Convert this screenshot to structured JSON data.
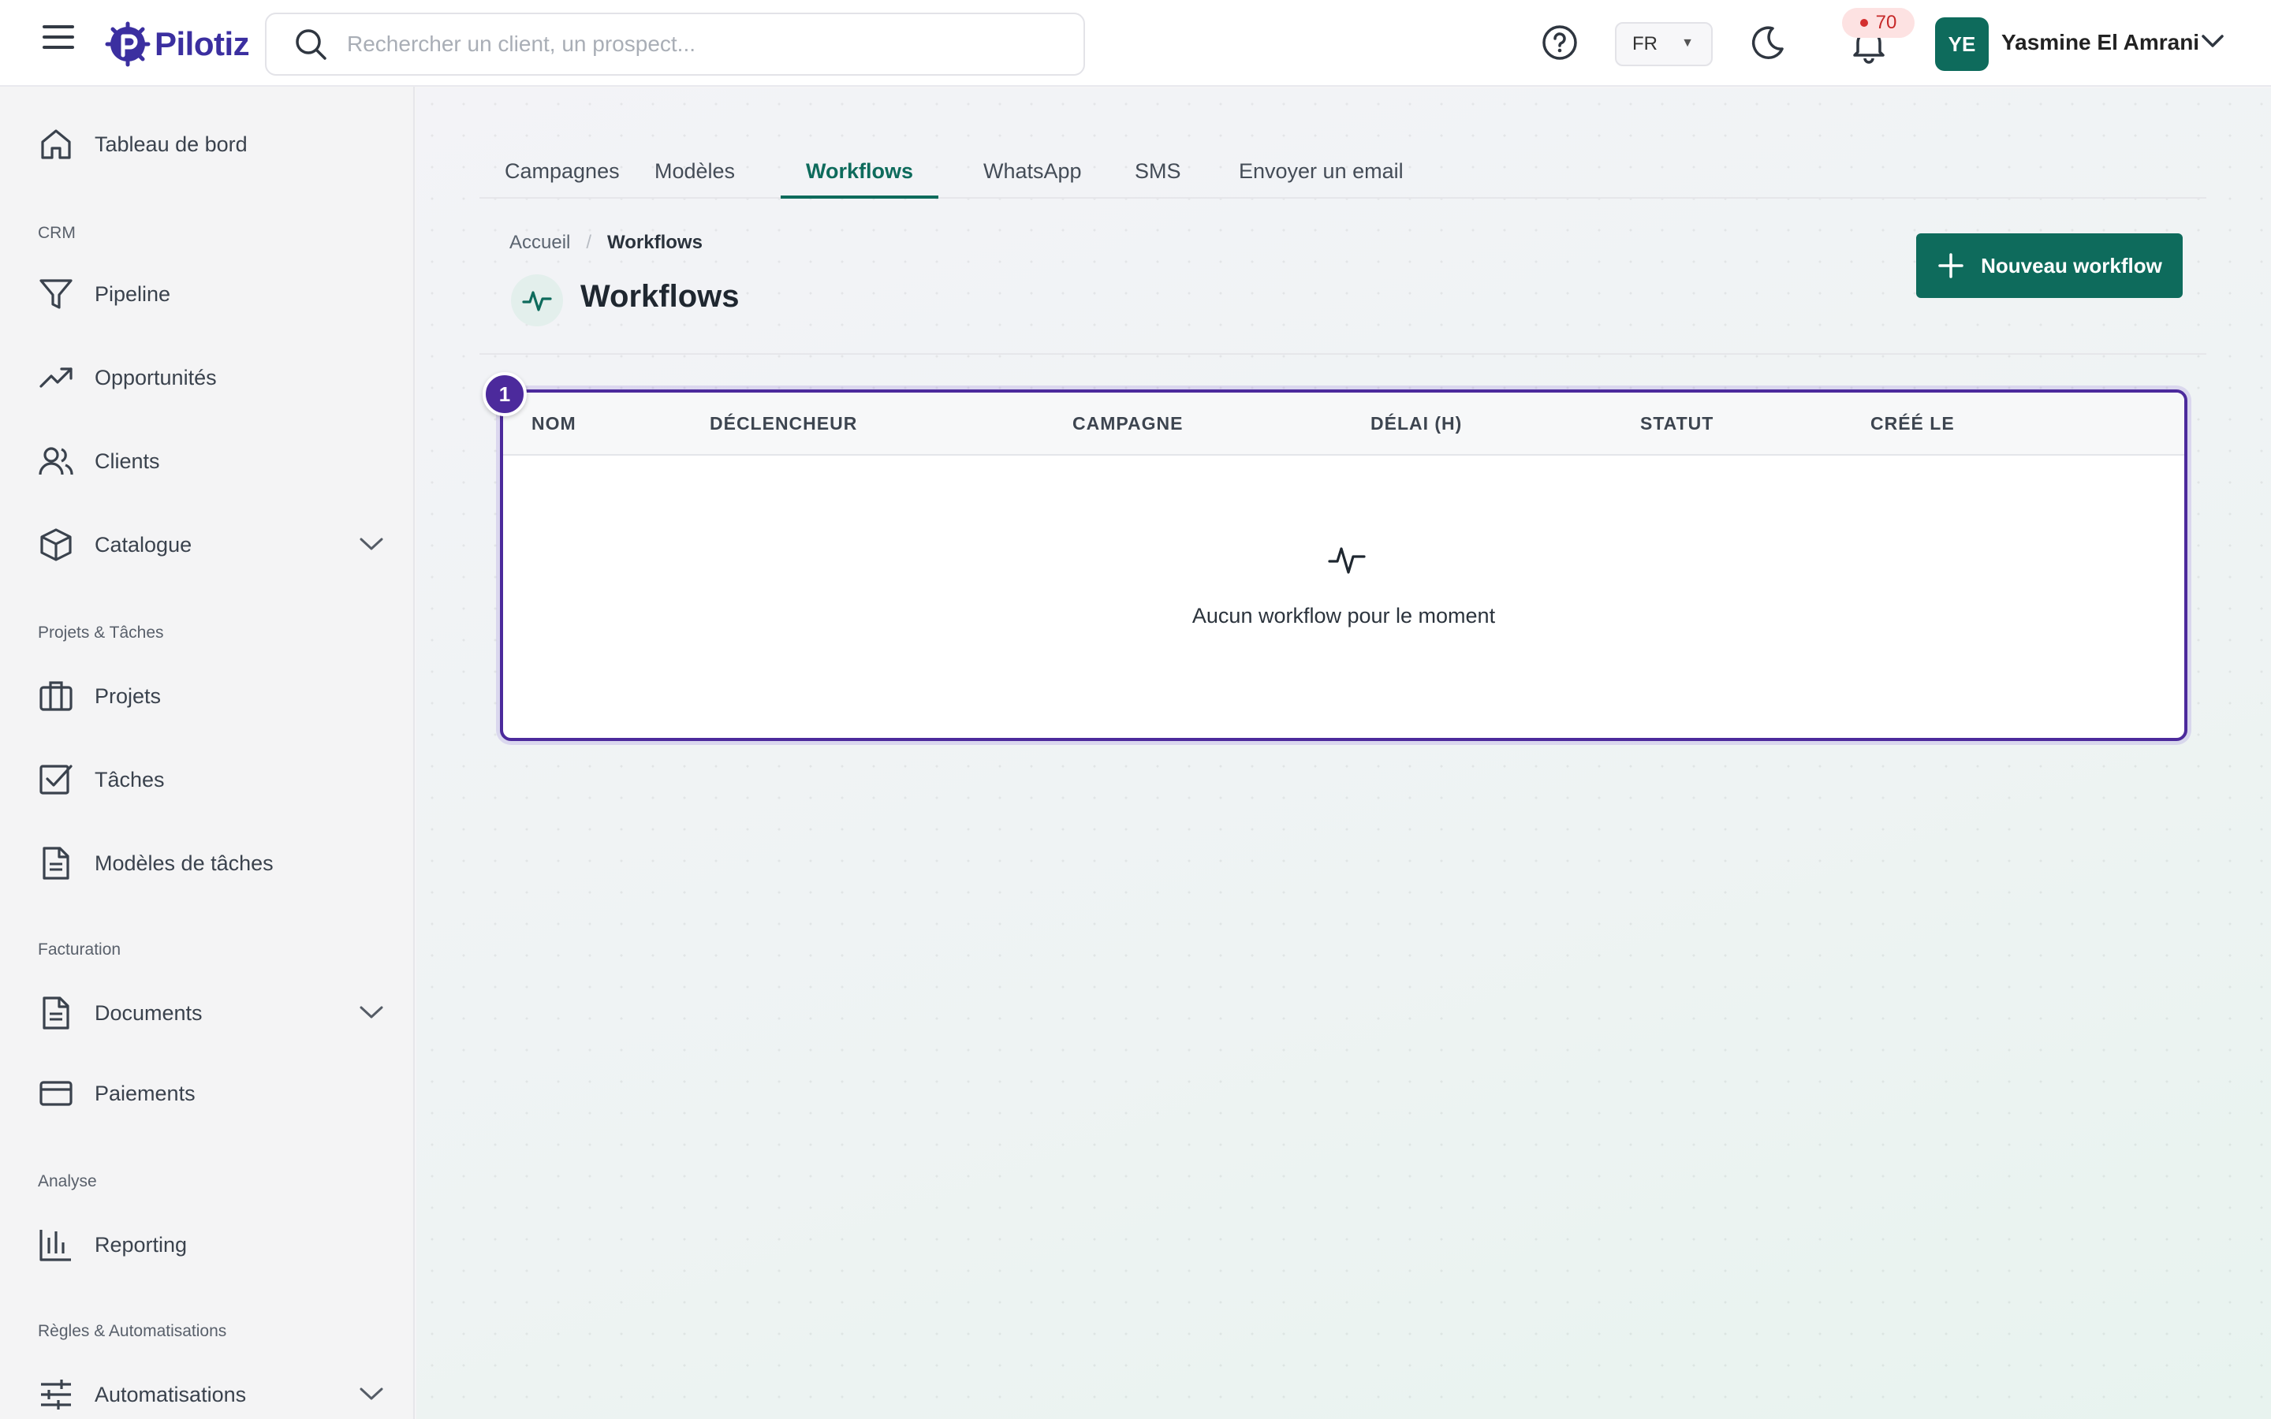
{
  "header": {
    "brand": "Pilotiz",
    "search_placeholder": "Rechercher un client, un prospect...",
    "language": "FR",
    "notification_count": "70",
    "user_initials": "YE",
    "user_name": "Yasmine El Amrani"
  },
  "sidebar": {
    "dashboard": "Tableau de bord",
    "sections": {
      "crm": "CRM",
      "projects": "Projets & Tâches",
      "billing": "Facturation",
      "analysis": "Analyse",
      "rules": "Règles & Automatisations"
    },
    "items": {
      "pipeline": "Pipeline",
      "opportunities": "Opportunités",
      "clients": "Clients",
      "catalog": "Catalogue",
      "projects": "Projets",
      "tasks": "Tâches",
      "task_templates": "Modèles de tâches",
      "documents": "Documents",
      "payments": "Paiements",
      "reporting": "Reporting",
      "automations": "Automatisations"
    }
  },
  "tabs": [
    "Campagnes",
    "Modèles",
    "Workflows",
    "WhatsApp",
    "SMS",
    "Envoyer un email"
  ],
  "active_tab": "Workflows",
  "breadcrumb": {
    "home": "Accueil",
    "current": "Workflows"
  },
  "page": {
    "title": "Workflows",
    "new_button": "Nouveau workflow"
  },
  "table": {
    "columns": [
      "NOM",
      "DÉCLENCHEUR",
      "CAMPAGNE",
      "DÉLAI (H)",
      "STATUT",
      "CRÉÉ LE"
    ],
    "empty_message": "Aucun workflow pour le moment"
  },
  "annotation_marker": "1",
  "colors": {
    "brand_green": "#0e6b5c",
    "brand_purple": "#3b2fa0",
    "highlight_purple": "#4c2a9c",
    "notification_red": "#d32f2f"
  }
}
